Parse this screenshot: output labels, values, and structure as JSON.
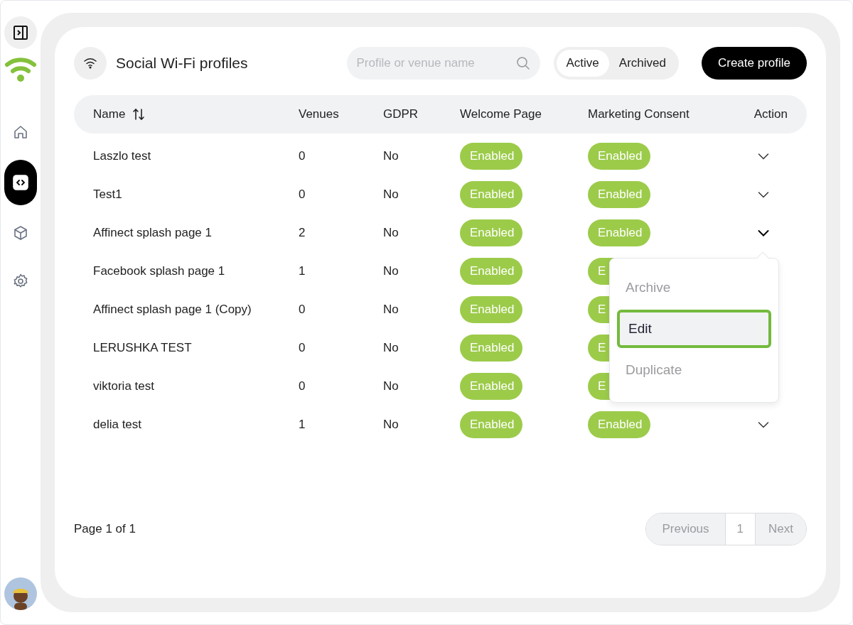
{
  "sidebar": {
    "items": [
      {
        "kind": "home",
        "selected": false
      },
      {
        "kind": "code",
        "selected": true
      },
      {
        "kind": "box",
        "selected": false
      },
      {
        "kind": "settings",
        "selected": false
      }
    ]
  },
  "header": {
    "title": "Social Wi-Fi profiles",
    "search": {
      "placeholder": "Profile or venue name"
    },
    "tabs": [
      {
        "label": "Active",
        "selected": true
      },
      {
        "label": "Archived",
        "selected": false
      }
    ],
    "create_button": "Create profile"
  },
  "table": {
    "columns": [
      "Name",
      "Venues",
      "GDPR",
      "Welcome Page",
      "Marketing Consent",
      "Action"
    ],
    "rows": [
      {
        "name": "Laszlo test",
        "venues": "0",
        "gdpr": "No",
        "welcome_page": "Enabled",
        "marketing_consent": "Enabled",
        "expanded": false
      },
      {
        "name": "Test1",
        "venues": "0",
        "gdpr": "No",
        "welcome_page": "Enabled",
        "marketing_consent": "Enabled",
        "expanded": false
      },
      {
        "name": "Affinect splash page 1",
        "venues": "2",
        "gdpr": "No",
        "welcome_page": "Enabled",
        "marketing_consent": "Enabled",
        "expanded": true
      },
      {
        "name": "Facebook splash page 1",
        "venues": "1",
        "gdpr": "No",
        "welcome_page": "Enabled",
        "marketing_consent": "E",
        "expanded": false
      },
      {
        "name": "Affinect splash page 1 (Copy)",
        "venues": "0",
        "gdpr": "No",
        "welcome_page": "Enabled",
        "marketing_consent": "E",
        "expanded": false
      },
      {
        "name": "LERUSHKA TEST",
        "venues": "0",
        "gdpr": "No",
        "welcome_page": "Enabled",
        "marketing_consent": "E",
        "expanded": false
      },
      {
        "name": "viktoria test",
        "venues": "0",
        "gdpr": "No",
        "welcome_page": "Enabled",
        "marketing_consent": "E",
        "expanded": false
      },
      {
        "name": "delia test",
        "venues": "1",
        "gdpr": "No",
        "welcome_page": "Enabled",
        "marketing_consent": "Enabled",
        "expanded": false
      }
    ]
  },
  "action_menu": {
    "items": [
      {
        "label": "Archive",
        "selected": false
      },
      {
        "label": "Edit",
        "selected": true
      },
      {
        "label": "Duplicate",
        "selected": false
      }
    ]
  },
  "pagination": {
    "summary": "Page 1 of 1",
    "previous": "Previous",
    "page": "1",
    "next": "Next"
  }
}
